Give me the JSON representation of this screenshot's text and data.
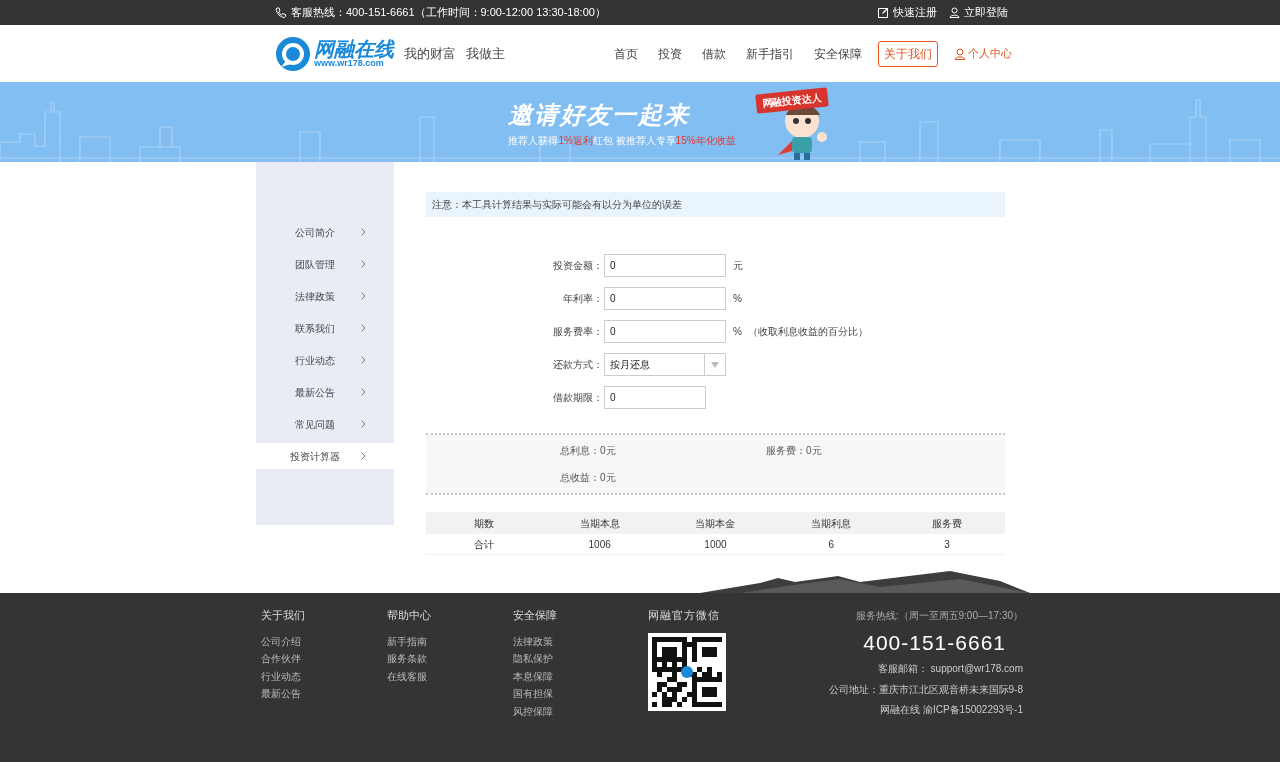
{
  "top_bar": {
    "hotline": "客服热线：400-151-6661（工作时间：9:00-12:00 13:30-18:00）",
    "links": [
      "快速注册",
      "立即登陆"
    ]
  },
  "header": {
    "logo_name": "网融在线",
    "logo_url": "www.wr178.com",
    "slogan": [
      "我的财富",
      "我做主"
    ],
    "nav": [
      {
        "label": "首页",
        "selected": false
      },
      {
        "label": "投资",
        "selected": false
      },
      {
        "label": "借款",
        "selected": false
      },
      {
        "label": "新手指引",
        "selected": false
      },
      {
        "label": "安全保障",
        "selected": false
      },
      {
        "label": "关于我们",
        "selected": true
      }
    ],
    "user_link": "个人中心"
  },
  "banner": {
    "title": "邀请好友一起来",
    "subtitle": [
      {
        "text": "推荐人获得",
        "highlight": false
      },
      {
        "text": "1%返利",
        "highlight": true
      },
      {
        "text": "红包 被推荐人专享",
        "highlight": false
      },
      {
        "text": "15%年化收益",
        "highlight": true
      }
    ],
    "ribbon": "网融投资达人"
  },
  "sidebar": {
    "items": [
      {
        "label": "公司简介",
        "selected": false
      },
      {
        "label": "团队管理",
        "selected": false
      },
      {
        "label": "法律政策",
        "selected": false
      },
      {
        "label": "联系我们",
        "selected": false
      },
      {
        "label": "行业动态",
        "selected": false
      },
      {
        "label": "最新公告",
        "selected": false
      },
      {
        "label": "常见问题",
        "selected": false
      },
      {
        "label": "投资计算器",
        "selected": true
      }
    ]
  },
  "notice": "注意：本工具计算结果与实际可能会有以分为单位的误差",
  "form": [
    {
      "kind": "input",
      "label": "投资金额：",
      "value": "0",
      "unit": "元"
    },
    {
      "kind": "input",
      "label": "年利率：",
      "value": "0",
      "unit": "%"
    },
    {
      "kind": "input",
      "label": "服务费率：",
      "value": "0",
      "unit": "%",
      "note": "（收取利息收益的百分比）"
    },
    {
      "kind": "select",
      "label": "还款方式：",
      "value": "按月还息"
    },
    {
      "kind": "short",
      "label": "借款期限：",
      "value": "0"
    }
  ],
  "summary": [
    [
      "总利息：0元",
      "服务费：0元"
    ],
    [
      "总收益：0元"
    ]
  ],
  "table": {
    "columns": [
      "期数",
      "当期本息",
      "当期本金",
      "当期利息",
      "服务费"
    ],
    "rows": [
      [
        "合计",
        "1006",
        "1000",
        "6",
        "3"
      ]
    ]
  },
  "footer": {
    "columns": [
      {
        "title": "关于我们",
        "links": [
          "公司介绍",
          "合作伙伴",
          "行业动态",
          "最新公告"
        ]
      },
      {
        "title": "帮助中心",
        "links": [
          "新手指南",
          "服务条款",
          "在线客服"
        ]
      },
      {
        "title": "安全保障",
        "links": [
          "法律政策",
          "隐私保护",
          "本息保障",
          "国有担保",
          "风控保障"
        ]
      }
    ],
    "wechat_title": "网融官方微信",
    "service_hours": "服务热线:（周一至周五9:00—17:30）",
    "phone": "400-151-6661",
    "email": "客服邮箱： support@wr178.com",
    "address": "公司地址：重庆市江北区观音桥未来国际9-8",
    "icp": "网融在线  渝ICP备15002293号-1"
  }
}
